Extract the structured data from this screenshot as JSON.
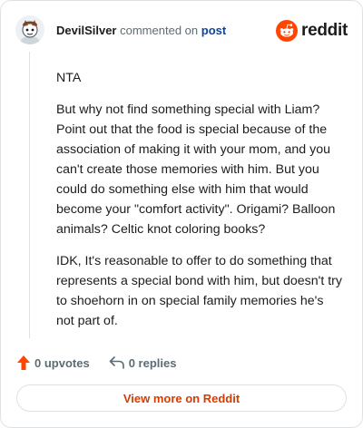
{
  "header": {
    "username": "DevilSilver",
    "action_text": "commented on",
    "post_link": "post",
    "logo_text": "reddit",
    "logo_icon": "reddit-snoo-icon",
    "avatar_icon": "user-avatar"
  },
  "comment": {
    "paragraphs": [
      "NTA",
      "But why not find something special with Liam? Point out that the food is special because of the association of making it with your mom, and you can't create those memories with him. But you could do something else with him that would become your \"comfort activity\". Origami? Balloon animals? Celtic knot coloring books?",
      "IDK, It's reasonable to offer to do something that represents a special bond with him, but doesn't try to shoehorn in on special family memories he's not part of."
    ]
  },
  "actions": {
    "upvotes_label": "0 upvotes",
    "upvote_icon": "upvote-arrow-icon",
    "replies_label": "0 replies",
    "reply_icon": "reply-arrow-icon"
  },
  "footer": {
    "view_more_label": "View more on Reddit"
  },
  "colors": {
    "accent": "#ff4500",
    "link": "#0a449b",
    "view_more": "#d93a00",
    "muted": "#5c6c74",
    "border": "#dfe1e3"
  }
}
